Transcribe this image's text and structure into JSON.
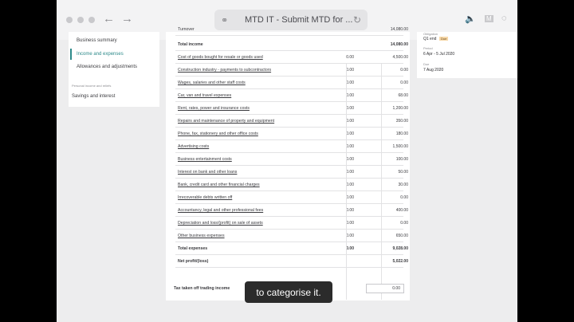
{
  "browser": {
    "tab_title": "MTD IT - Submit MTD for ...",
    "back_icon": "arrow-left-icon",
    "forward_icon": "arrow-right-icon",
    "link_icon": "link-icon",
    "reload_icon": "reload-icon"
  },
  "sidebar": {
    "items": [
      "Business summary",
      "Income and expenses",
      "Allowances and adjustments"
    ],
    "section_label": "Personal income and reliefs",
    "extra_item": "Savings and interest"
  },
  "table": {
    "cut_label": "Turnover",
    "cut_value": "14,080.00",
    "rows": [
      {
        "label": "Total income",
        "c1": "",
        "c2": "14,080.00",
        "style": "bold"
      },
      {
        "label": "Cost of goods bought for resale or goods used",
        "c1": "0.00",
        "c2": "4,500.00",
        "style": "link"
      },
      {
        "label": "Construction industry - payments to subcontractors",
        "c1": "0.00",
        "c2": "0.00",
        "style": "link"
      },
      {
        "label": "Wages, salaries and other staff costs",
        "c1": "0.00",
        "c2": "0.00",
        "style": "link"
      },
      {
        "label": "Car, van and travel expenses",
        "c1": "0.00",
        "c2": "68.00",
        "style": "link"
      },
      {
        "label": "Rent, rates, power and insurance costs",
        "c1": "0.00",
        "c2": "1,200.00",
        "style": "link"
      },
      {
        "label": "Repairs and maintenance of property and equipment",
        "c1": "0.00",
        "c2": "350.00",
        "style": "link"
      },
      {
        "label": "Phone, fax, stationery and other office costs",
        "c1": "0.00",
        "c2": "180.00",
        "style": "link"
      },
      {
        "label": "Advertising costs",
        "c1": "0.00",
        "c2": "1,500.00",
        "style": "link"
      },
      {
        "label": "Business entertainment costs",
        "c1": "0.00",
        "c2": "100.00",
        "style": "link"
      },
      {
        "label": "Interest on bank and other loans",
        "c1": "0.00",
        "c2": "50.00",
        "style": "link"
      },
      {
        "label": "Bank, credit card and other financial charges",
        "c1": "0.00",
        "c2": "30.00",
        "style": "link"
      },
      {
        "label": "Irrecoverable debts written off",
        "c1": "0.00",
        "c2": "0.00",
        "style": "link"
      },
      {
        "label": "Accountancy, legal and other professional fees",
        "c1": "0.00",
        "c2": "400.00",
        "style": "link"
      },
      {
        "label": "Depreciation and loss/(profit) on sale of assets",
        "c1": "0.00",
        "c2": "0.00",
        "style": "link"
      },
      {
        "label": "Other business expenses",
        "c1": "0.00",
        "c2": "650.00",
        "style": "link"
      },
      {
        "label": "Total expenses",
        "c1": "0.00",
        "c2": "9,028.00",
        "style": "bold"
      },
      {
        "label": "Net profit/(loss)",
        "c1": "",
        "c2": "5,022.00",
        "style": "bold"
      }
    ]
  },
  "tax": {
    "label": "Tax taken off trading income",
    "value": "0.00"
  },
  "caption": "to categorise it.",
  "obligation": {
    "heading": "Obligation",
    "period_label": "Q1 end",
    "badge": "Due",
    "period_heading": "Period",
    "period_value": "6 Apr - 5 Jul 2020",
    "due_heading": "Due",
    "due_value": "7 Aug 2020"
  }
}
